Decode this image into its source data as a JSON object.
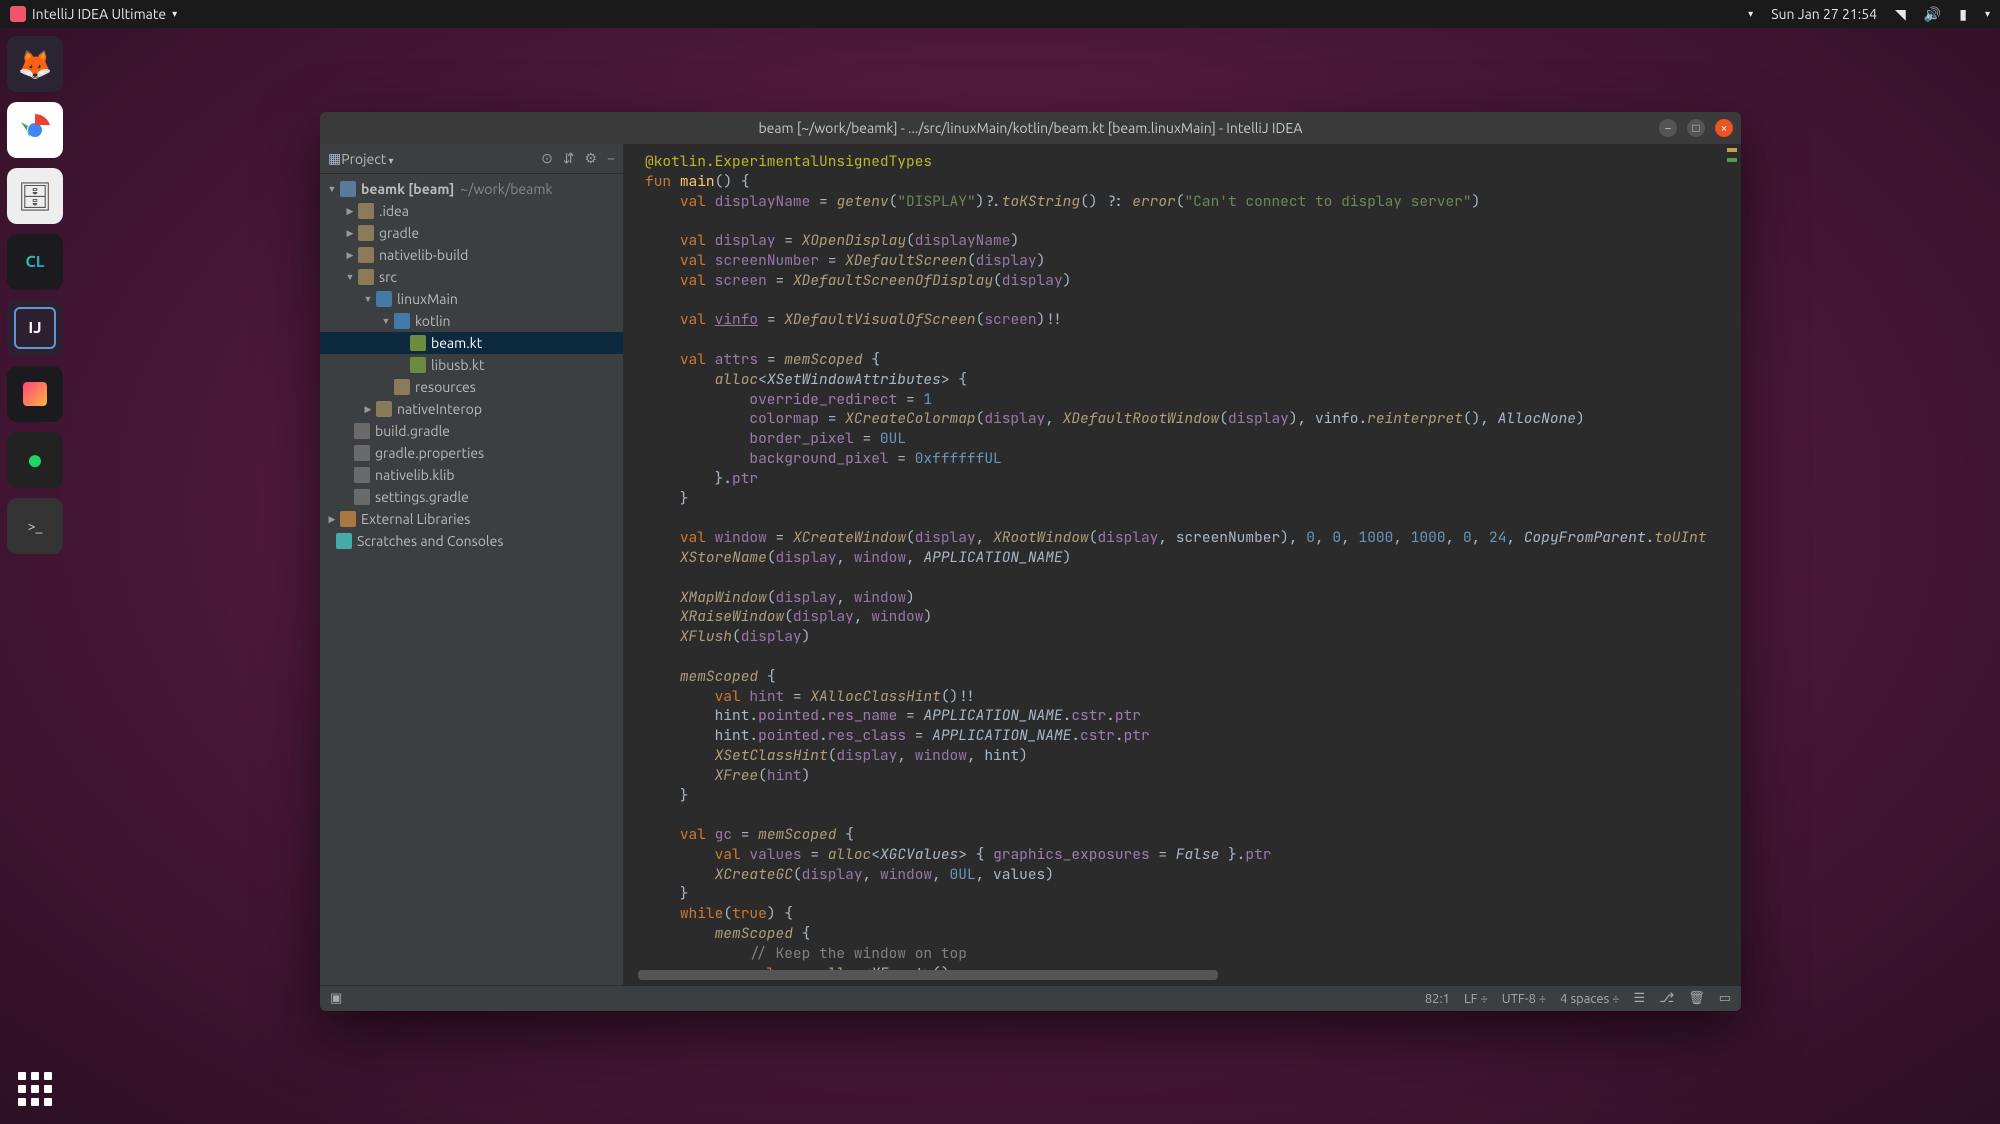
{
  "topbar": {
    "app_name": "IntelliJ IDEA Ultimate",
    "datetime": "Sun Jan 27  21:54"
  },
  "dock": {
    "items": [
      "firefox",
      "chrome",
      "files",
      "clion",
      "intellij",
      "toolbox",
      "spotify",
      "terminal"
    ]
  },
  "ide": {
    "title": "beam [~/work/beamk] - .../src/linuxMain/kotlin/beam.kt [beam.linuxMain] - IntelliJ IDEA",
    "project_label": "Project",
    "tree": {
      "root_label": "beamk [beam]",
      "root_path": "~/work/beamk",
      "folders": {
        "idea": ".idea",
        "gradle": "gradle",
        "nativelib": "nativelib-build",
        "src": "src",
        "linuxMain": "linuxMain",
        "kotlin": "kotlin",
        "beam": "beam.kt",
        "libusb": "libusb.kt",
        "resources": "resources",
        "nativeInterop": "nativeInterop",
        "build_gradle": "build.gradle",
        "gradle_props": "gradle.properties",
        "nativelib_klib": "nativelib.klib",
        "settings_gradle": "settings.gradle",
        "ext_libs": "External Libraries",
        "scratches": "Scratches and Consoles"
      }
    }
  },
  "status": {
    "pos": "82:1",
    "le": "LF",
    "enc": "UTF-8",
    "indent": "4 spaces"
  }
}
